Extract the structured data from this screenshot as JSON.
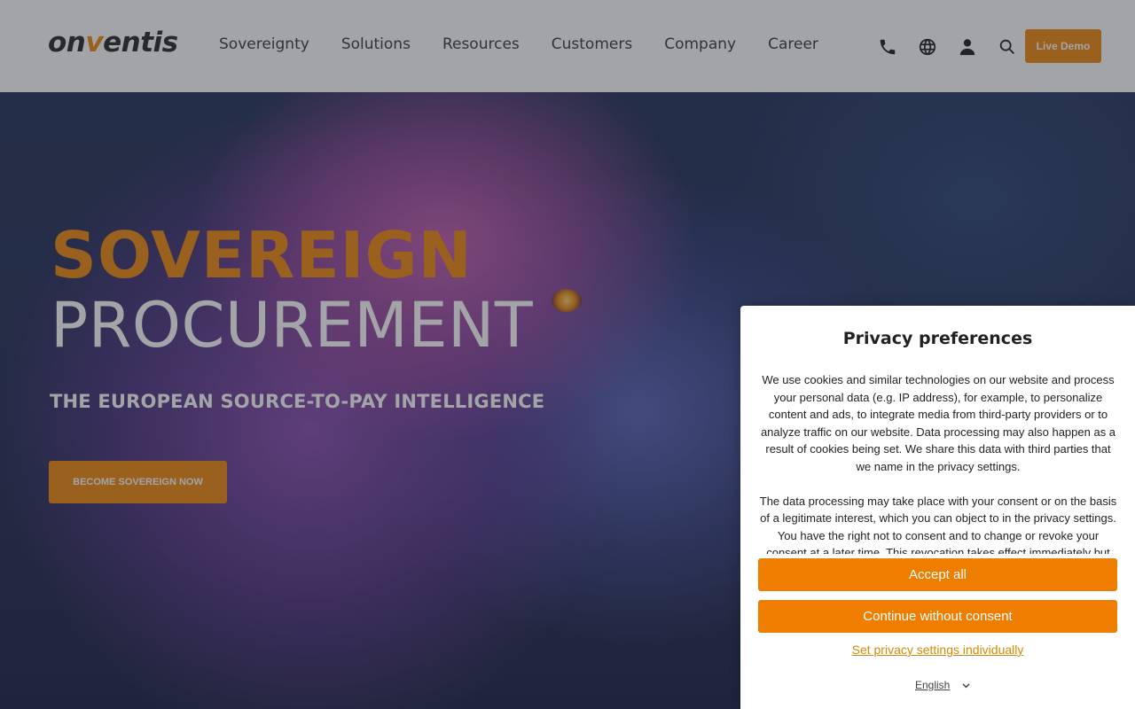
{
  "header": {
    "logo": {
      "part1": "on",
      "part2": "v",
      "part3": "entis"
    },
    "nav": [
      {
        "label": "Sovereignty"
      },
      {
        "label": "Solutions"
      },
      {
        "label": "Resources"
      },
      {
        "label": "Customers"
      },
      {
        "label": "Company"
      },
      {
        "label": "Career"
      }
    ],
    "icons": [
      "phone-icon",
      "globe-icon",
      "user-icon",
      "search-icon"
    ],
    "live_demo": "Live Demo"
  },
  "hero": {
    "title_line1": "SOVEREIGN",
    "title_line2": "PROCUREMENT",
    "subtitle": "THE EUROPEAN SOURCE-TO-PAY INTELLIGENCE",
    "cta": "BECOME SOVEREIGN NOW"
  },
  "privacy": {
    "title": "Privacy preferences",
    "paragraph1": "We use cookies and similar technologies on our website and process your personal data (e.g. IP address), for example, to personalize content and ads, to integrate media from third-party providers or to analyze traffic on our website. Data processing may also happen as a result of cookies being set. We share this data with third parties that we name in the privacy settings.",
    "paragraph2": "The data processing may take place with your consent or on the basis of a legitimate interest, which you can object to in the privacy settings. You have the right not to consent and to change or revoke your consent at a later time. This revocation takes effect immediately but does not affect",
    "accept_all": "Accept all",
    "continue_without": "Continue without consent",
    "set_individually": "Set privacy settings individually",
    "language": "English"
  },
  "colors": {
    "brand_orange": "#ef8a12",
    "button_orange": "#ef7d00",
    "link_orange": "#d58a06"
  }
}
